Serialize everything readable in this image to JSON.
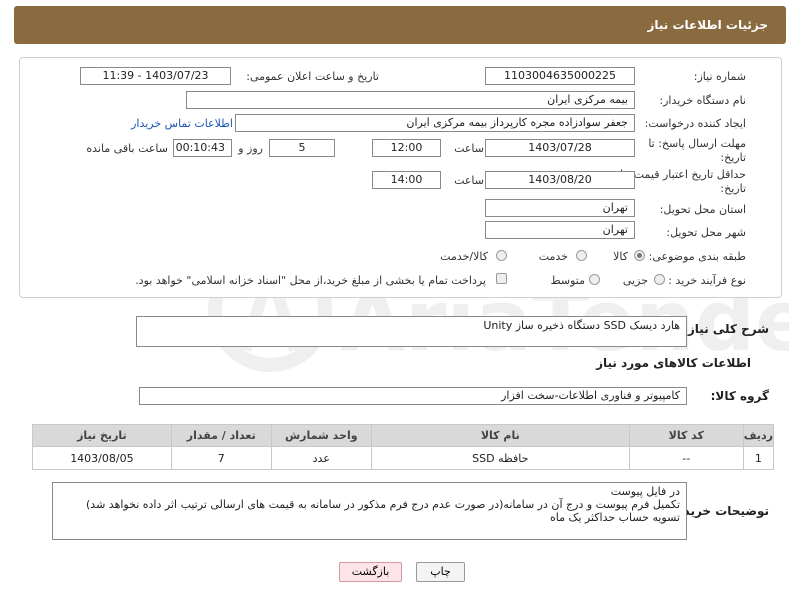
{
  "header": {
    "title": "جزئیات اطلاعات نیاز"
  },
  "form": {
    "need_number_label": "شماره نیاز:",
    "need_number": "1103004635000225",
    "announce_label": "تاریخ و ساعت اعلان عمومی:",
    "announce_value": "1403/07/23 - 11:39",
    "buyer_org_label": "نام دستگاه خریدار:",
    "buyer_org": "بیمه مرکزی ایران",
    "creator_label": "ایجاد کننده درخواست:",
    "creator": "جعفر سوادزاده مجره کارپرداز بیمه مرکزی ایران",
    "contact_link": "اطلاعات تماس خریدار",
    "reply_deadline_label_1": "مهلت ارسال پاسخ: تا",
    "reply_deadline_label_2": "تاریخ:",
    "reply_date": "1403/07/28",
    "time_label": "ساعت",
    "reply_time": "12:00",
    "days_value": "5",
    "days_label": "روز و",
    "remaining_time": "00:10:43",
    "remaining_label": "ساعت باقی مانده",
    "price_deadline_label_1": "حداقل تاریخ اعتبار قیمت: تا",
    "price_deadline_label_2": "تاریخ:",
    "price_date": "1403/08/20",
    "price_time": "14:00",
    "province_label": "استان محل تحویل:",
    "province": "تهران",
    "city_label": "شهر محل تحویل:",
    "city": "تهران",
    "category_label": "طبقه بندی موضوعی:",
    "category_options": [
      "کالا",
      "خدمت",
      "کالا/خدمت"
    ],
    "process_label": "نوع فرآیند خرید :",
    "process_options": [
      "جزیی",
      "متوسط"
    ],
    "payment_note": "پرداخت تمام یا بخشی از مبلغ خرید،از محل \"اسناد خزانه اسلامی\" خواهد بود."
  },
  "description": {
    "label": "شرح کلی نیاز:",
    "value": "هارد دیسک SSD دستگاه ذخیره ساز Unity"
  },
  "goods_info": {
    "title": "اطلاعات کالاهای مورد نیاز",
    "group_label": "گروه کالا:",
    "group_value": "کامپیوتر و فناوری اطلاعات-سخت افزار"
  },
  "table": {
    "headers": [
      "ردیف",
      "کد کالا",
      "نام کالا",
      "واحد شمارش",
      "تعداد / مقدار",
      "تاریخ نیاز"
    ],
    "rows": [
      [
        "1",
        "--",
        "حافظه SSD",
        "عدد",
        "7",
        "1403/08/05"
      ]
    ]
  },
  "buyer_notes": {
    "label": "توضیحات خریدار:",
    "lines": [
      "در فایل پیوست",
      "تکمیل فرم پیوست و درج آن در سامانه(در صورت عدم درج فرم مذکور در سامانه به قیمت های ارسالی ترتیب اثر داده نخواهد شد)",
      "تسویه حساب حداکثر یک ماه"
    ]
  },
  "buttons": {
    "print": "چاپ",
    "back": "بازگشت"
  },
  "watermark": {
    "text": "AriaTender.net"
  }
}
